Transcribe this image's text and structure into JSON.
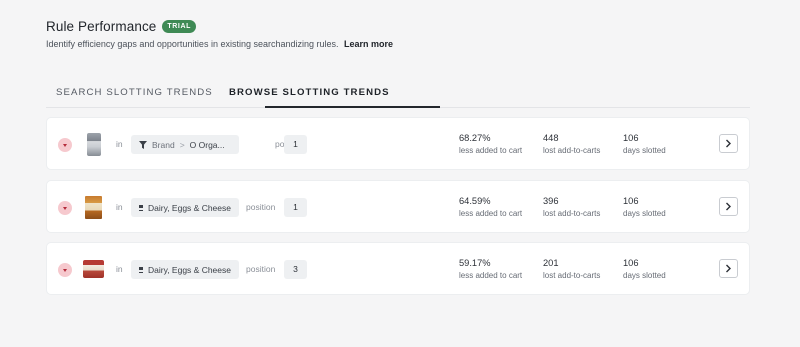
{
  "header": {
    "title": "Rule Performance",
    "badge": "TRIAL",
    "subtitle": "Identify efficiency gaps and opportunities in existing searchandizing rules.",
    "learn_more": "Learn more"
  },
  "tabs": [
    {
      "label": "SEARCH SLOTTING TRENDS",
      "active": false
    },
    {
      "label": "BROWSE SLOTTING TRENDS",
      "active": true
    }
  ],
  "labels": {
    "in": "in",
    "position": "position",
    "metric1": "less added to cart",
    "metric2": "lost add-to-carts",
    "metric3": "days slotted"
  },
  "rows": [
    {
      "filter_type": "Brand",
      "filter_sep": ">",
      "filter_value": "O Orga...",
      "position": "1",
      "pct": "68.27%",
      "lost": "448",
      "days": "106"
    },
    {
      "category": "Dairy, Eggs & Cheese",
      "position": "1",
      "pct": "64.59%",
      "lost": "396",
      "days": "106"
    },
    {
      "category": "Dairy, Eggs & Cheese",
      "position": "3",
      "pct": "59.17%",
      "lost": "201",
      "days": "106"
    }
  ],
  "colors": {
    "badge": "#3f8a55",
    "toggle_bg": "#f6c9ce",
    "toggle_arrow": "#b42a3a",
    "active_tab": "#23272d"
  },
  "icons": {
    "toggle": "chevron-down-icon",
    "brand_filter": "filter-icon",
    "category": "list-icon",
    "navigate": "chevron-right-icon"
  }
}
